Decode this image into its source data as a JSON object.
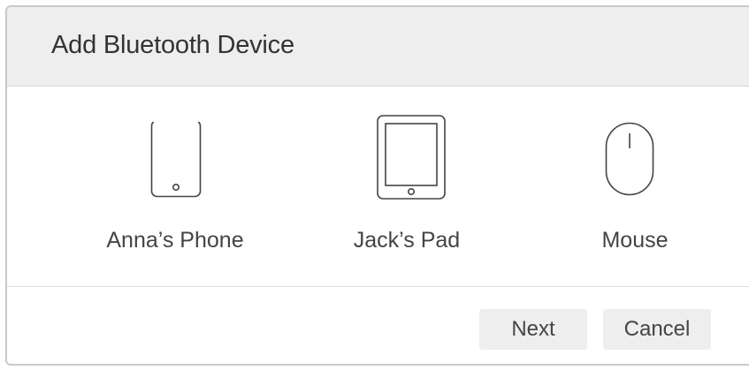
{
  "dialog": {
    "title": "Add Bluetooth Device"
  },
  "devices": [
    {
      "label": "Anna’s Phone",
      "icon": "phone-icon"
    },
    {
      "label": "Jack’s Pad",
      "icon": "tablet-icon"
    },
    {
      "label": "Mouse",
      "icon": "mouse-icon"
    }
  ],
  "footer": {
    "next_label": "Next",
    "cancel_label": "Cancel"
  },
  "colors": {
    "header_background": "#eeeeee",
    "button_background": "#eeeeee",
    "icon_stroke": "#444444"
  }
}
